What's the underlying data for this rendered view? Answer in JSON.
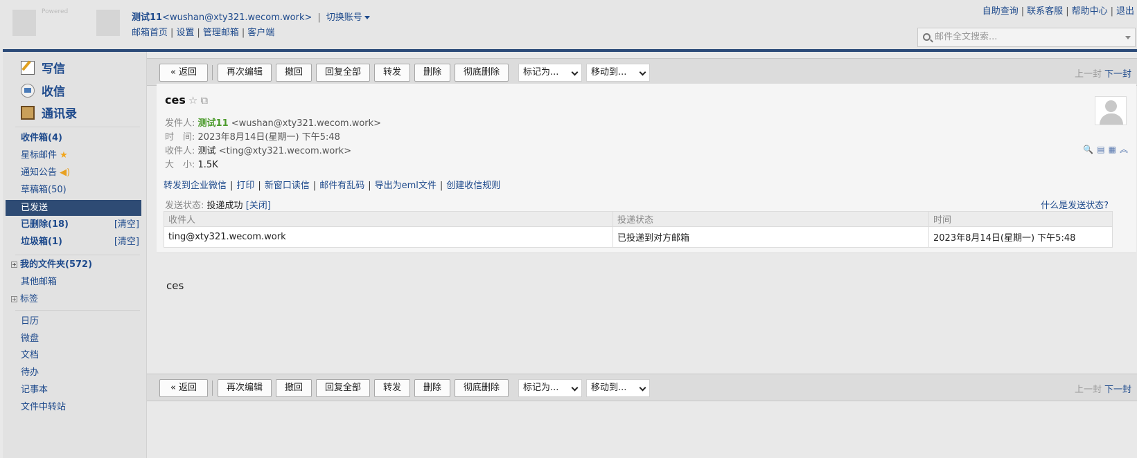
{
  "header": {
    "logo_text": "Powered",
    "account_name": "测试11",
    "account_email": "<wushan@xty321.wecom.work>",
    "switch_account": "切换账号",
    "nav_links": [
      "邮箱首页",
      "设置",
      "管理邮箱",
      "客户端"
    ],
    "right_links": [
      "自助查询",
      "联系客服",
      "帮助中心",
      "退出"
    ],
    "search_placeholder": "邮件全文搜索..."
  },
  "sidebar": {
    "write": "写信",
    "receive": "收信",
    "contacts": "通讯录",
    "inbox": "收件箱(4)",
    "starred": "星标邮件",
    "notices": "通知公告",
    "drafts": "草稿箱(50)",
    "sent": "已发送",
    "deleted": "已删除(18)",
    "spam": "垃圾箱(1)",
    "clear_label": "[清空]",
    "my_folders": "我的文件夹(572)",
    "other_mail": "其他邮箱",
    "tags": "标签",
    "apps": [
      "日历",
      "微盘",
      "文档",
      "待办",
      "记事本",
      "文件中转站"
    ]
  },
  "toolbar": {
    "back": "« 返回",
    "reedit": "再次编辑",
    "recall": "撤回",
    "reply_all": "回复全部",
    "forward": "转发",
    "delete": "删除",
    "delete_perm": "彻底删除",
    "mark_as": "标记为...",
    "move_to": "移动到...",
    "prev": "上一封",
    "next": "下一封"
  },
  "mail": {
    "subject": "ces",
    "from_label": "发件人:",
    "from_name": "测试11",
    "from_email": "<wushan@xty321.wecom.work>",
    "time_label": "时　间:",
    "time_value": "2023年8月14日(星期一) 下午5:48",
    "to_label": "收件人:",
    "to_name": "测试",
    "to_email": "<ting@xty321.wecom.work>",
    "size_label": "大　小:",
    "size_value": "1.5K",
    "actions": [
      "转发到企业微信",
      "打印",
      "新窗口读信",
      "邮件有乱码",
      "导出为eml文件",
      "创建收信规则"
    ],
    "send_status_label": "发送状态:",
    "send_status_value": "投递成功",
    "send_status_close": "[关闭]",
    "what_is_status": "什么是发送状态?",
    "status_table": {
      "headers": [
        "收件人",
        "投递状态",
        "时间"
      ],
      "rows": [
        [
          "ting@xty321.wecom.work",
          "已投递到对方邮箱",
          "2023年8月14日(星期一) 下午5:48"
        ]
      ]
    },
    "body": "ces"
  },
  "colors": {
    "accent": "#2e4b74",
    "link": "#1e4a8c",
    "sender_name": "#4a9a2a",
    "star": "#f2a51a"
  }
}
